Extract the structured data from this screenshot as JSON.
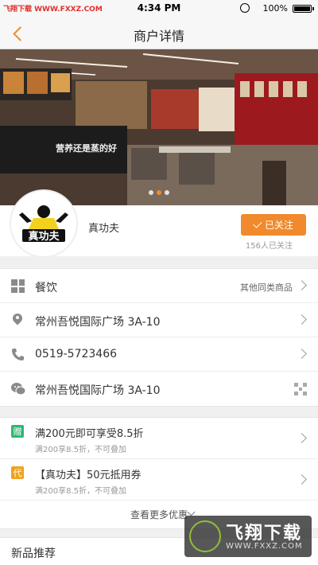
{
  "status_bar": {
    "watermark_text": "飞翔下载 WWW.FXXZ.COM",
    "time": "4:34 PM",
    "battery": "100%"
  },
  "nav": {
    "title": "商户详情"
  },
  "merchant": {
    "name": "真功夫",
    "logo_text": "真功夫",
    "follow_label": "已关注",
    "follow_count": "156人已关注"
  },
  "info": {
    "category": "餐饮",
    "category_link": "其他同类商品",
    "address": "常州吾悦国际广场 3A-10",
    "phone": "0519-5723466",
    "wechat": "常州吾悦国际广场 3A-10"
  },
  "promos": [
    {
      "tag": "赠",
      "tag_color": "#2eb872",
      "title": "满200元即可享受8.5折",
      "subtitle": "满200享8.5折，不可叠加"
    },
    {
      "tag": "代",
      "tag_color": "#f0a21e",
      "title": "【真功夫】50元抵用券",
      "subtitle": "满200享8.5折，不可叠加"
    }
  ],
  "more_label": "查看更多优惠",
  "new_section_label": "新品推荐",
  "overlay_watermark": {
    "title": "飞翔下载",
    "url": "WWW.FXXZ.COM"
  },
  "colors": {
    "accent": "#f08a2c"
  }
}
